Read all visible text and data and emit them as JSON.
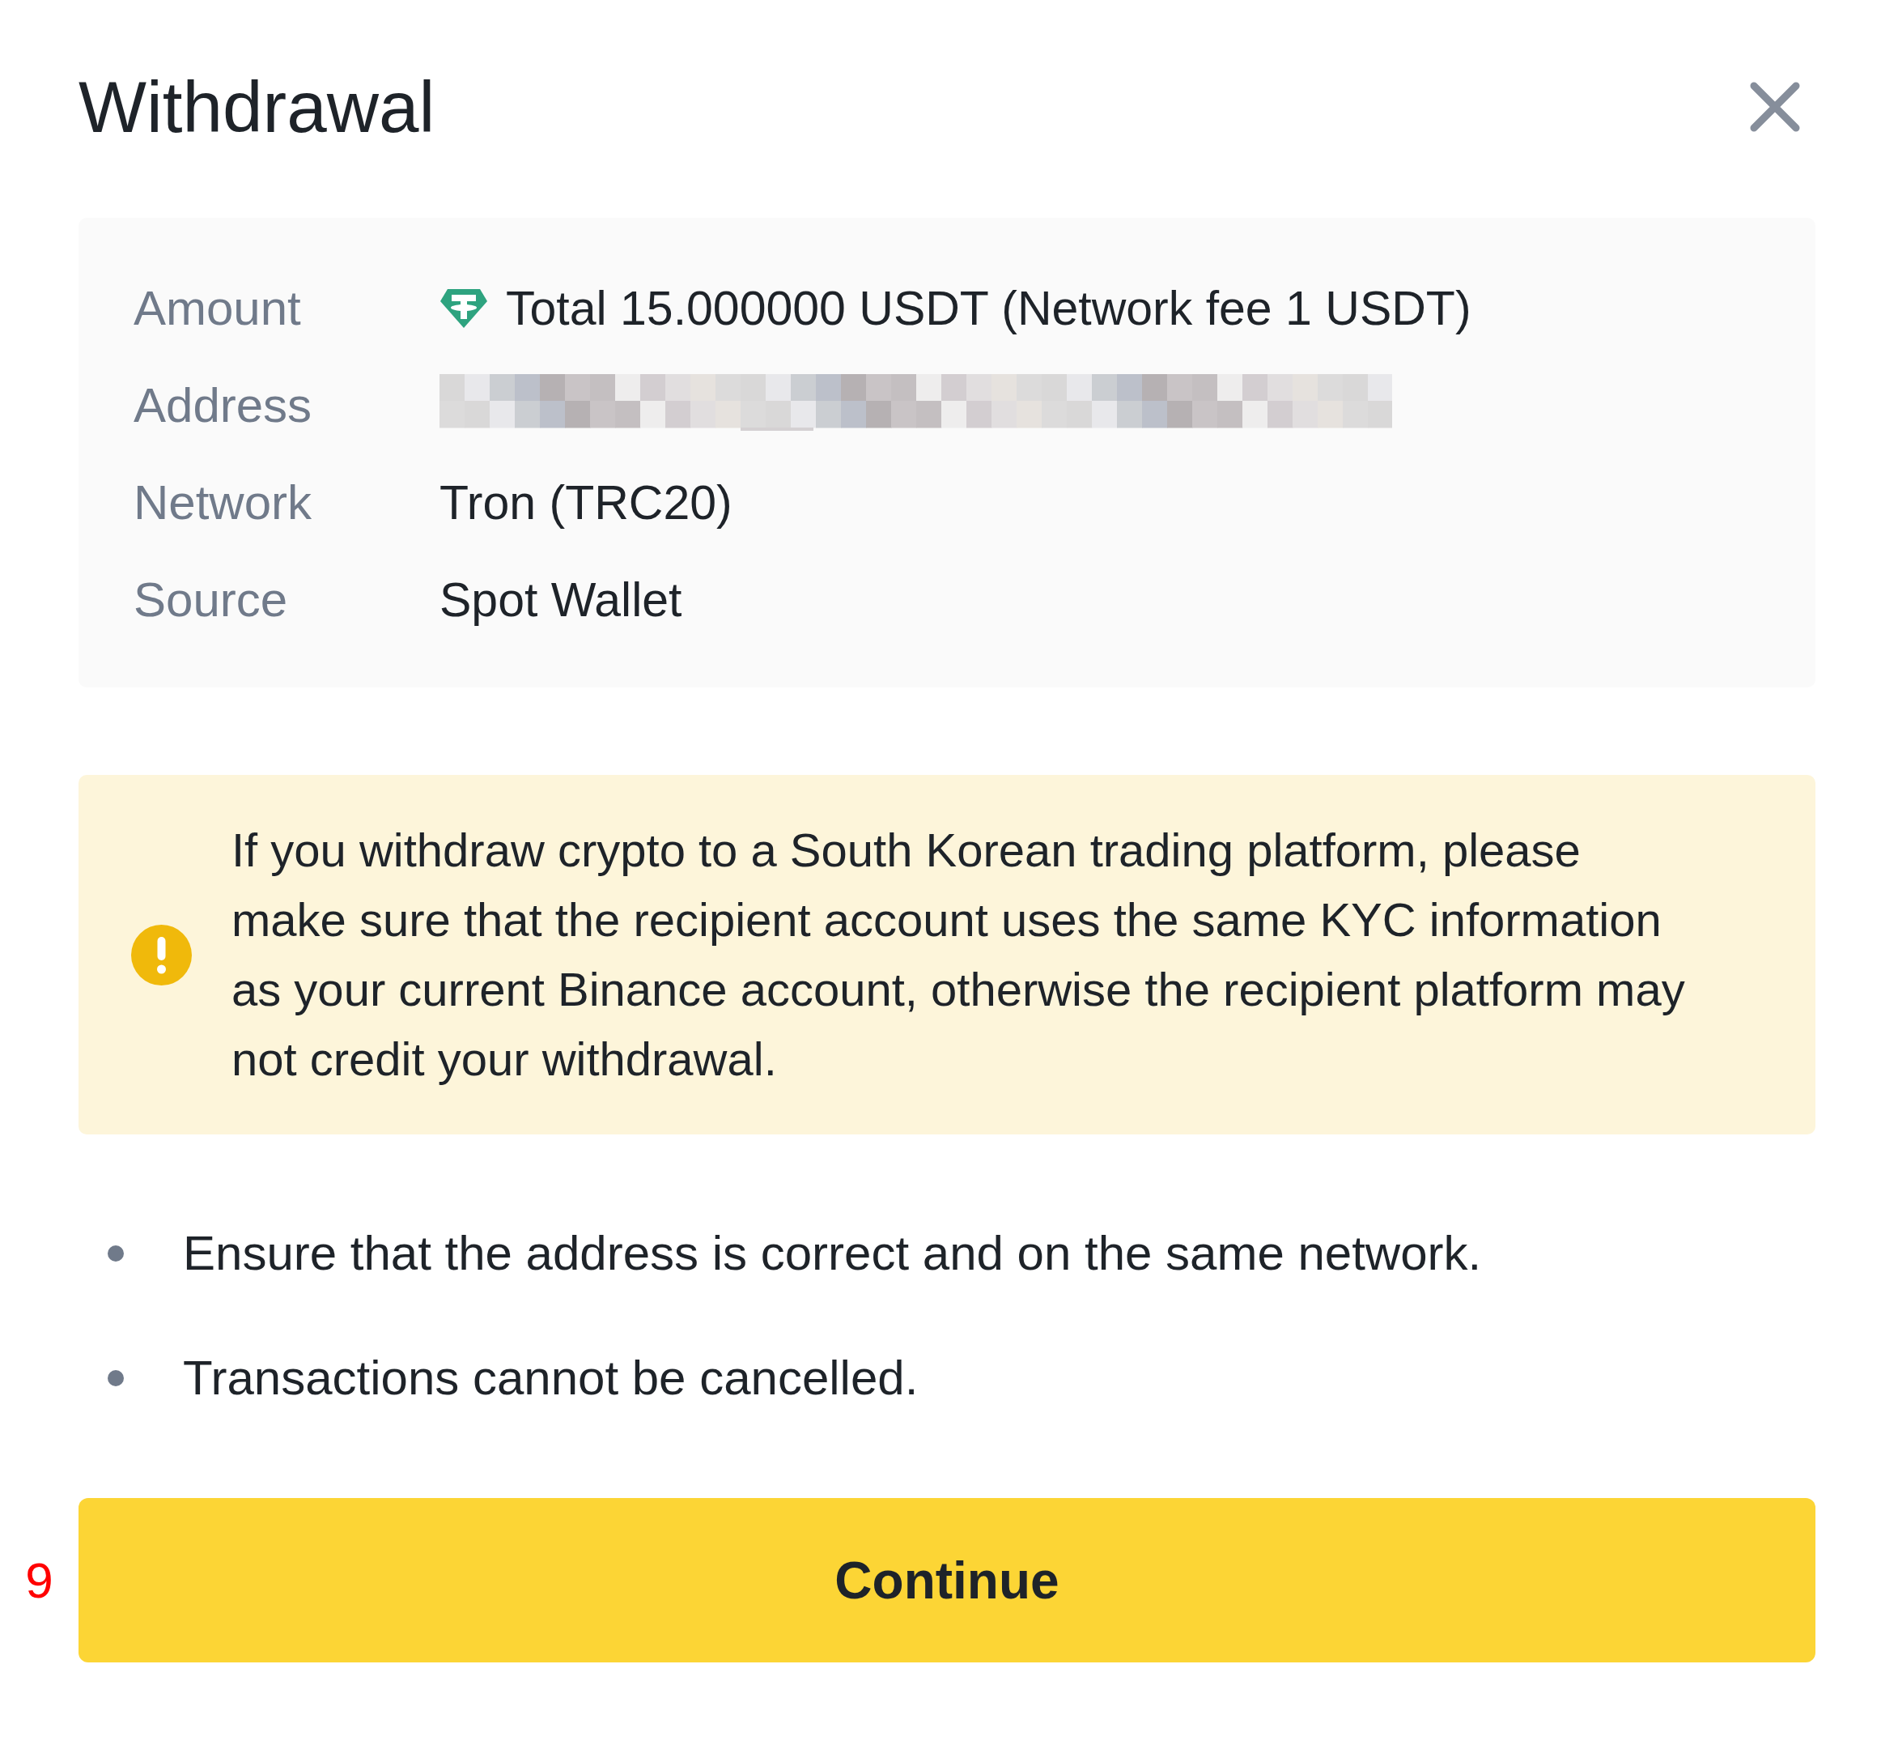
{
  "dialog": {
    "title": "Withdrawal"
  },
  "details": [
    {
      "label": "Amount",
      "kind": "amount",
      "value": "Total 15.000000 USDT (Network fee 1 USDT)"
    },
    {
      "label": "Address",
      "kind": "redacted"
    },
    {
      "label": "Network",
      "kind": "text",
      "value": "Tron (TRC20)"
    },
    {
      "label": "Source",
      "kind": "text",
      "value": "Spot Wallet"
    }
  ],
  "warning": {
    "text": "If you withdraw crypto to a South Korean trading platform, please make sure that the recipient account uses the same KYC information as your current Binance account, otherwise the recipient platform may not credit your withdrawal."
  },
  "notes": [
    "Ensure that the address is correct and on the same network.",
    "Transactions cannot be cancelled."
  ],
  "primary_button": {
    "label": "Continue"
  },
  "step_marker": "9"
}
